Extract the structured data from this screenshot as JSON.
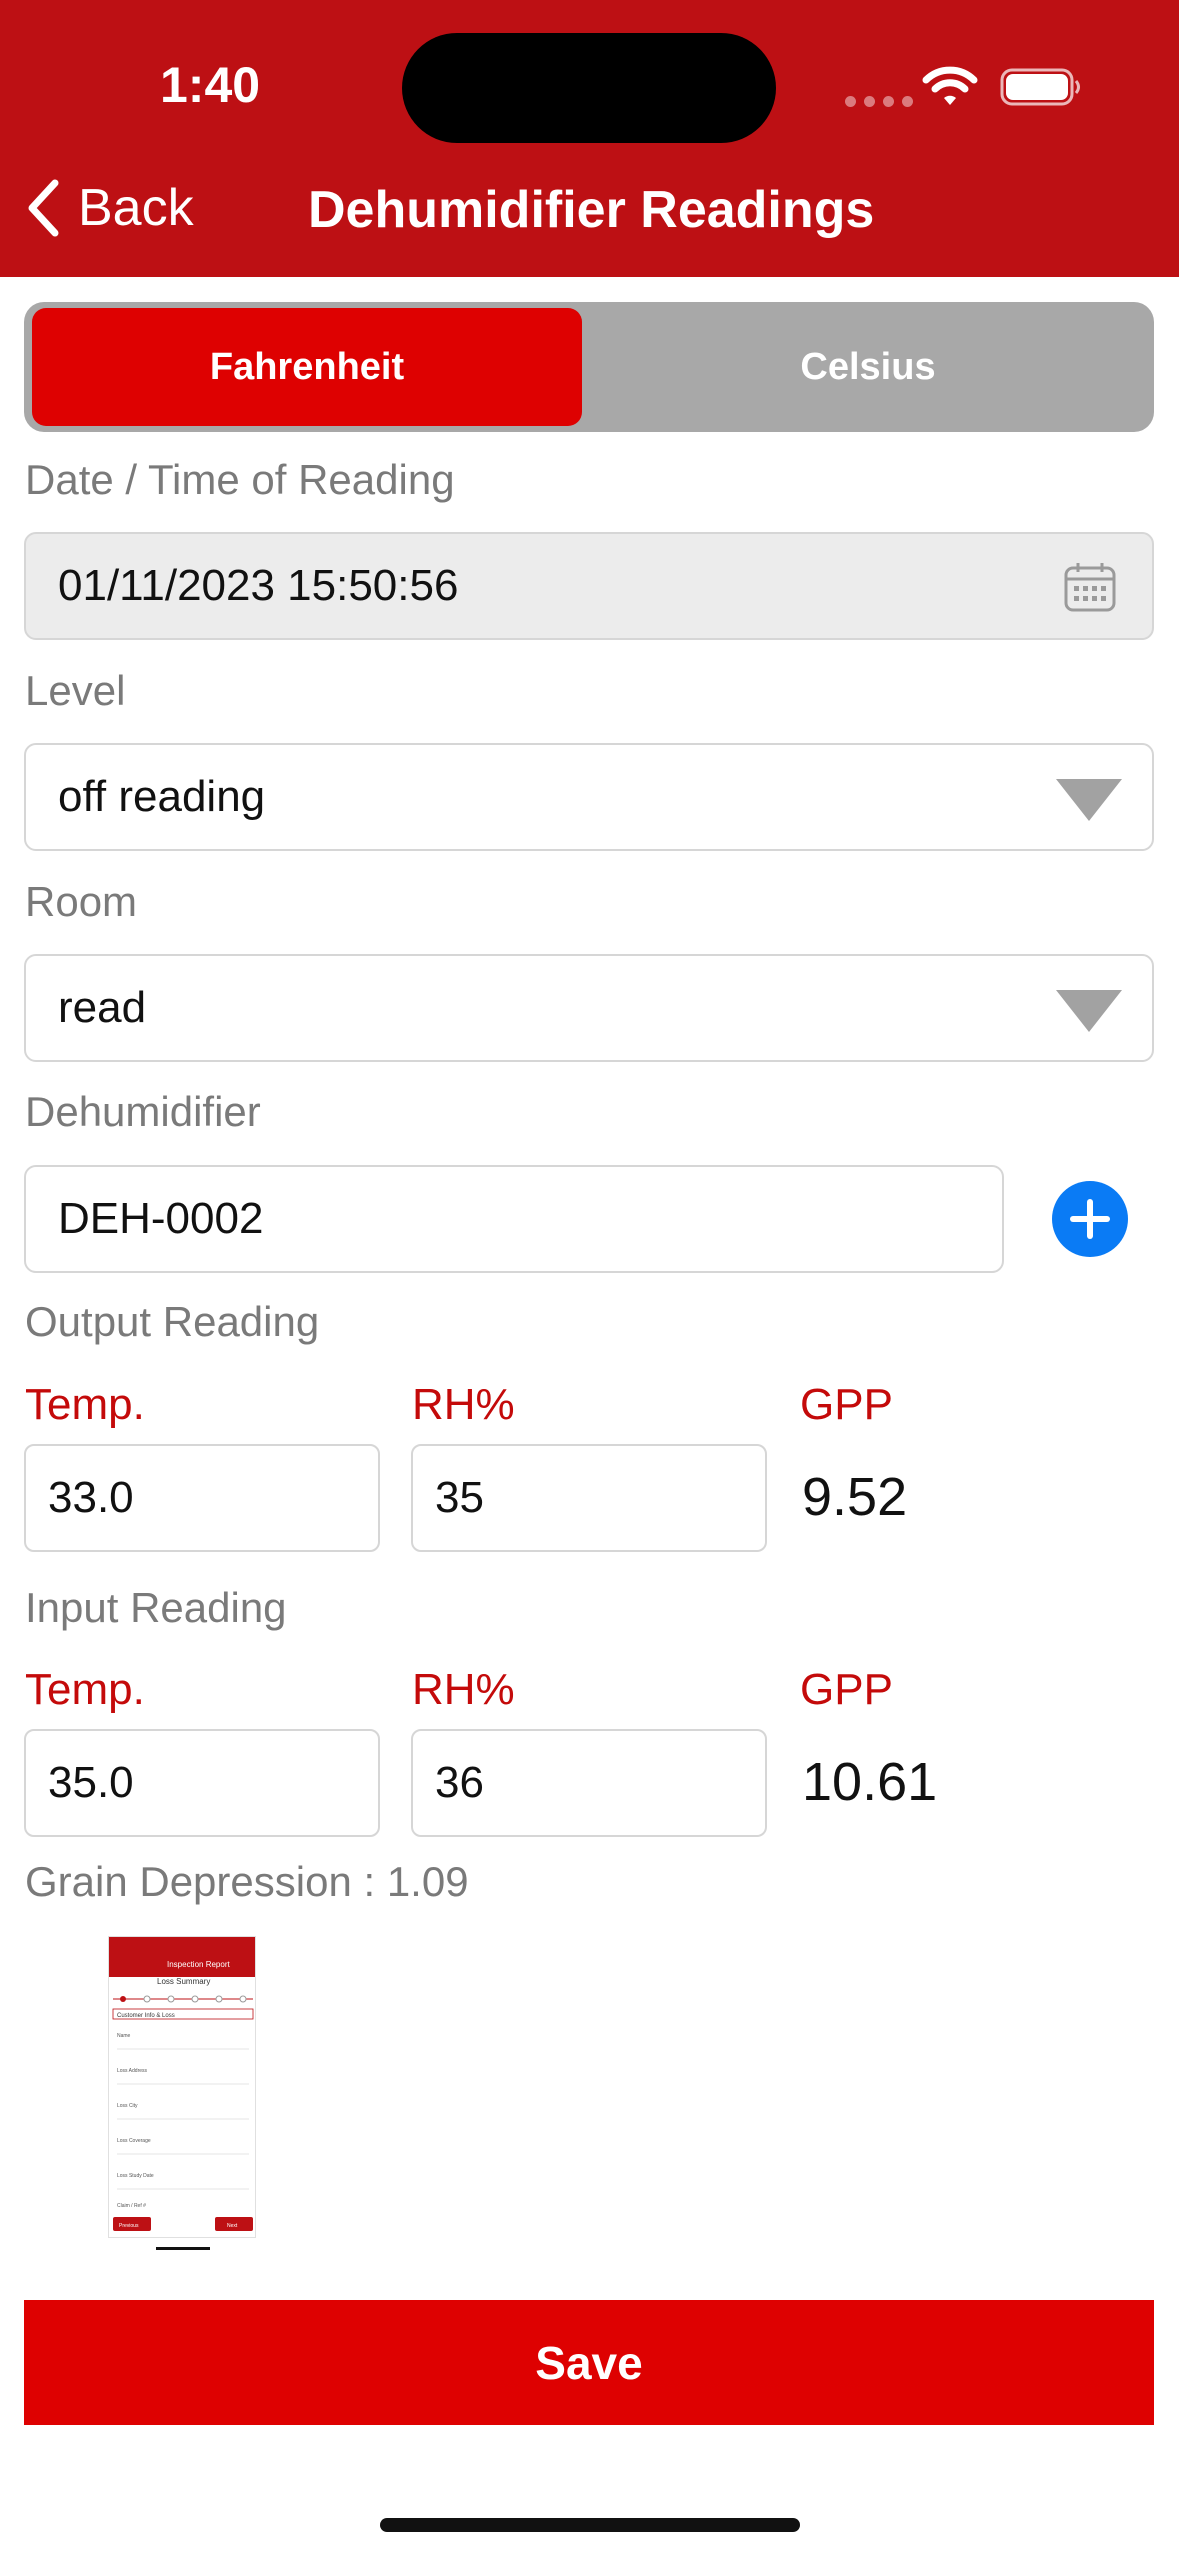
{
  "status_bar": {
    "time": "1:40"
  },
  "nav": {
    "back_label": "Back",
    "title": "Dehumidifier Readings"
  },
  "unit_toggle": {
    "options": [
      "Fahrenheit",
      "Celsius"
    ],
    "selected": "Fahrenheit"
  },
  "form": {
    "date_label": "Date / Time of Reading",
    "date_value": "01/11/2023 15:50:56",
    "level_label": "Level",
    "level_value": "off reading",
    "room_label": "Room",
    "room_value": "read",
    "dehumidifier_label": "Dehumidifier",
    "dehumidifier_value": "DEH-0002"
  },
  "output_reading": {
    "label": "Output Reading",
    "temp_label": "Temp.",
    "rh_label": "RH%",
    "gpp_label": "GPP",
    "temp_value": "33.0",
    "rh_value": "35",
    "gpp_value": "9.52"
  },
  "input_reading": {
    "label": "Input Reading",
    "temp_label": "Temp.",
    "rh_label": "RH%",
    "gpp_label": "GPP",
    "temp_value": "35.0",
    "rh_value": "36",
    "gpp_value": "10.61"
  },
  "grain_depression": "Grain Depression : 1.09",
  "thumbnail": {
    "header_title": "Inspection Report",
    "subtitle": "Loss Summary",
    "section": "Customer Info & Loss",
    "fields": [
      "Name",
      "Loss Address",
      "Loss City",
      "Loss Coverage",
      "Loss Study Date",
      "Claim / Ref #"
    ],
    "left_button": "Previous",
    "right_button": "Next"
  },
  "save_label": "Save",
  "colors": {
    "header": "#bd1014",
    "accent": "#de0101",
    "label_red": "#c40a0a",
    "plus_blue": "#0a7bf5"
  }
}
